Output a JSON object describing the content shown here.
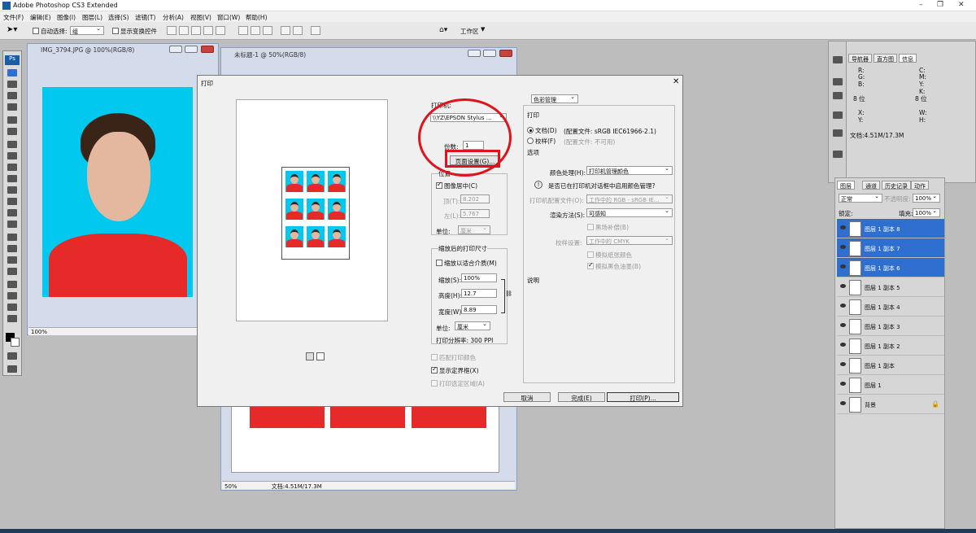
{
  "app": {
    "title": "Adobe Photoshop CS3 Extended"
  },
  "menu": [
    "文件(F)",
    "编辑(E)",
    "图像(I)",
    "图层(L)",
    "选择(S)",
    "滤镜(T)",
    "分析(A)",
    "视图(V)",
    "窗口(W)",
    "帮助(H)"
  ],
  "options": {
    "auto_select": "自动选择:",
    "group_value": "组",
    "show_transform": "显示变换控件",
    "workspace": "工作区"
  },
  "doc1": {
    "title": "IMG_3794.JPG @ 100%(RGB/8)",
    "zoom": "100%"
  },
  "doc2": {
    "title": "未标题-1 @ 50%(RGB/8)",
    "zoom": "50%",
    "doc_size": "文档:4.51M/17.3M"
  },
  "dialog": {
    "title": "打印",
    "printer_label": "打印机:",
    "printer_value": "\\\\YZ\\EPSON Stylus ...",
    "copies_label": "份数:",
    "copies_value": "1",
    "page_setup": "页面设置(G)...",
    "position_label": "位置",
    "center_image": "图像居中(C)",
    "top_label": "顶(T):",
    "top_value": "8.202",
    "left_label": "左(L):",
    "left_value": "5.767",
    "unit_label": "单位:",
    "unit_value": "厘米",
    "scaled_label": "缩放后的打印尺寸",
    "scale_to_fit": "缩放以适合介质(M)",
    "scale_label": "缩放(S):",
    "scale_value": "100%",
    "height_label": "高度(H):",
    "height_value": "12.7",
    "width_label": "宽度(W):",
    "width_value": "8.89",
    "unit2_value": "厘米",
    "resolution": "打印分辨率: 300 PPI",
    "match_colors": "匹配打印颜色",
    "show_bbox": "显示定界框(X)",
    "print_selected": "打印选定区域(A)",
    "color_mgmt": "色彩管理",
    "print_section": "打印",
    "doc_radio": "文档(D)",
    "doc_profile": "(配置文件: sRGB IEC61966-2.1)",
    "proof_radio": "校样(F)",
    "proof_profile": "(配置文件: 不可用)",
    "options_section": "选项",
    "color_handling_label": "颜色处理(H):",
    "color_handling_value": "打印机管理颜色",
    "warning_icon": "info-icon",
    "warning_text": "是否已在打印机对话框中启用颜色管理?",
    "printer_profile_label": "打印机配置文件(O):",
    "printer_profile_value": "工作中的 RGB - sRGB IE...",
    "intent_label": "渲染方法(S):",
    "intent_value": "可感知",
    "bpc": "黑场补偿(B)",
    "proof_setup_label": "校样设置:",
    "proof_setup_value": "工作中的 CMYK",
    "sim_paper": "模拟纸张颜色",
    "sim_black": "模拟黑色油墨(B)",
    "description_label": "说明",
    "cancel": "取消",
    "done": "完成(E)",
    "print": "打印(P)..."
  },
  "panels": {
    "nav_tabs": [
      "导航器",
      "直方图",
      "信息"
    ],
    "info": {
      "r": "R:",
      "g": "G:",
      "b": "B:",
      "c": "C:",
      "m": "M:",
      "y": "Y:",
      "k": "K:",
      "bits1": "8 位",
      "bits2": "8 位",
      "x": "X:",
      "yy": "Y:",
      "w": "W:",
      "h": "H:",
      "doc": "文档:4.51M/17.3M"
    },
    "layer_tabs": [
      "图层",
      "通道",
      "历史记录",
      "动作"
    ],
    "blend": "正常",
    "opacity_label": "不透明度:",
    "opacity": "100%",
    "lock_label": "锁定:",
    "fill_label": "填充:",
    "fill": "100%",
    "layers": [
      "图层 1 副本 8",
      "图层 1 副本 7",
      "图层 1 副本 6",
      "图层 1 副本 5",
      "图层 1 副本 4",
      "图层 1 副本 3",
      "图层 1 副本 2",
      "图层 1 副本",
      "图层 1",
      "背景"
    ]
  },
  "colors": {
    "accent": "#2e6fcf",
    "annotation": "#e0131d",
    "photo_bg": "#00c8ef",
    "coat": "#e62a2a"
  }
}
